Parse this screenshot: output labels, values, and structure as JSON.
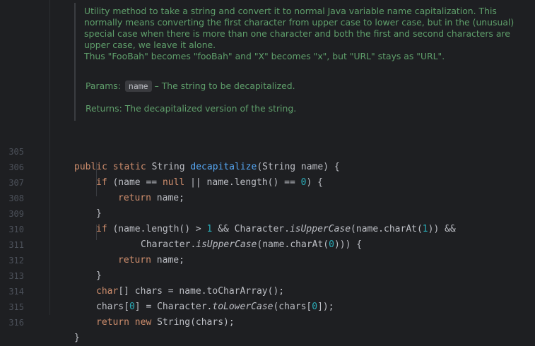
{
  "doc": {
    "lines": [
      "Utility method to take a string and convert it to normal Java variable name capitalization. This",
      "normally means converting the first character from upper case to lower case, but in the (unusual)",
      "special case when there is more than one character and both the first and second characters are",
      "upper case, we leave it alone.",
      "Thus \"FooBah\" becomes \"fooBah\" and \"X\" becomes \"x\", but \"URL\" stays as \"URL\"."
    ],
    "params_label": "Params:",
    "param_name": "name",
    "param_desc": "– The string to be decapitalized.",
    "returns_label": "Returns:",
    "returns_desc": "The decapitalized version of the string."
  },
  "code": {
    "line_numbers": [
      "305",
      "306",
      "307",
      "308",
      "309",
      "310",
      "311",
      "312",
      "313",
      "314",
      "315",
      "316"
    ],
    "tokens": {
      "public": "public",
      "static": "static",
      "string": "String",
      "method": "decapitalize",
      "sig_rest": "(String name) {",
      "if": "if",
      "l306_a": "(name == ",
      "null": "null",
      "l306_b": " || name.length() == ",
      "zero": "0",
      "l306_c": ") {",
      "return": "return",
      "name_semi": " name;",
      "close_brace": "}",
      "l309_a": "(name.length() > ",
      "one": "1",
      "l309_b": " && Character.",
      "isUpper": "isUpperCase",
      "l309_c": "(name.charAt(",
      "l309_d": ")) &&",
      "l310_a": "Character.",
      "l310_b": "(name.charAt(",
      "l310_c": "))) {",
      "char": "char",
      "l313_rest": "[] chars = name.toCharArray();",
      "l314_a": "chars[",
      "l314_b": "] = Character.",
      "toLower": "toLowerCase",
      "l314_c": "(chars[",
      "l314_d": "]);",
      "new": "new",
      "l315_rest": " String(chars);"
    }
  }
}
